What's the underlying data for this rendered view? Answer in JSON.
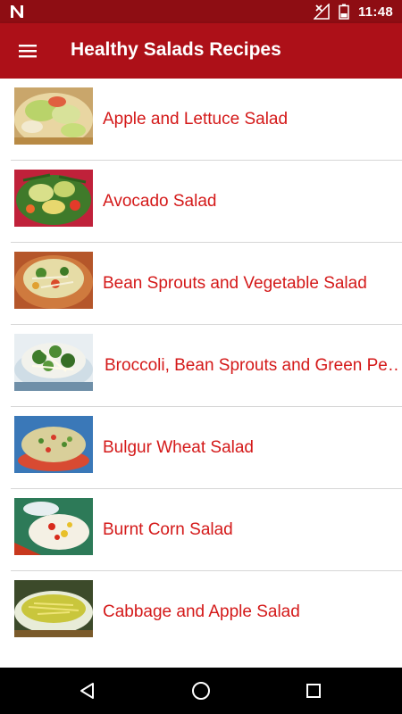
{
  "status_bar": {
    "time": "11:48",
    "icons": [
      "n-notification-icon",
      "no-signal-icon",
      "battery-icon"
    ]
  },
  "app_bar": {
    "title": "Healthy Salads Recipes",
    "menu_icon": "hamburger-menu-icon"
  },
  "recipes": [
    {
      "label": "Apple and Lettuce Salad",
      "thumb": "apple-lettuce-salad-image"
    },
    {
      "label": "Avocado Salad",
      "thumb": "avocado-salad-image"
    },
    {
      "label": "Bean Sprouts and Vegetable Salad",
      "thumb": "bean-sprouts-salad-image"
    },
    {
      "label": "Broccoli, Bean Sprouts and Green Pe…",
      "thumb": "broccoli-salad-image"
    },
    {
      "label": "Bulgur Wheat Salad",
      "thumb": "bulgur-wheat-salad-image"
    },
    {
      "label": "Burnt Corn Salad",
      "thumb": "burnt-corn-salad-image"
    },
    {
      "label": "Cabbage and Apple Salad",
      "thumb": "cabbage-apple-salad-image"
    }
  ],
  "nav_bar": {
    "icons": [
      "back-icon",
      "home-icon",
      "recents-icon"
    ]
  },
  "colors": {
    "status_bar": "#8e0d13",
    "app_bar": "#ad1018",
    "item_text": "#d41919",
    "divider": "#d6d6d6"
  }
}
